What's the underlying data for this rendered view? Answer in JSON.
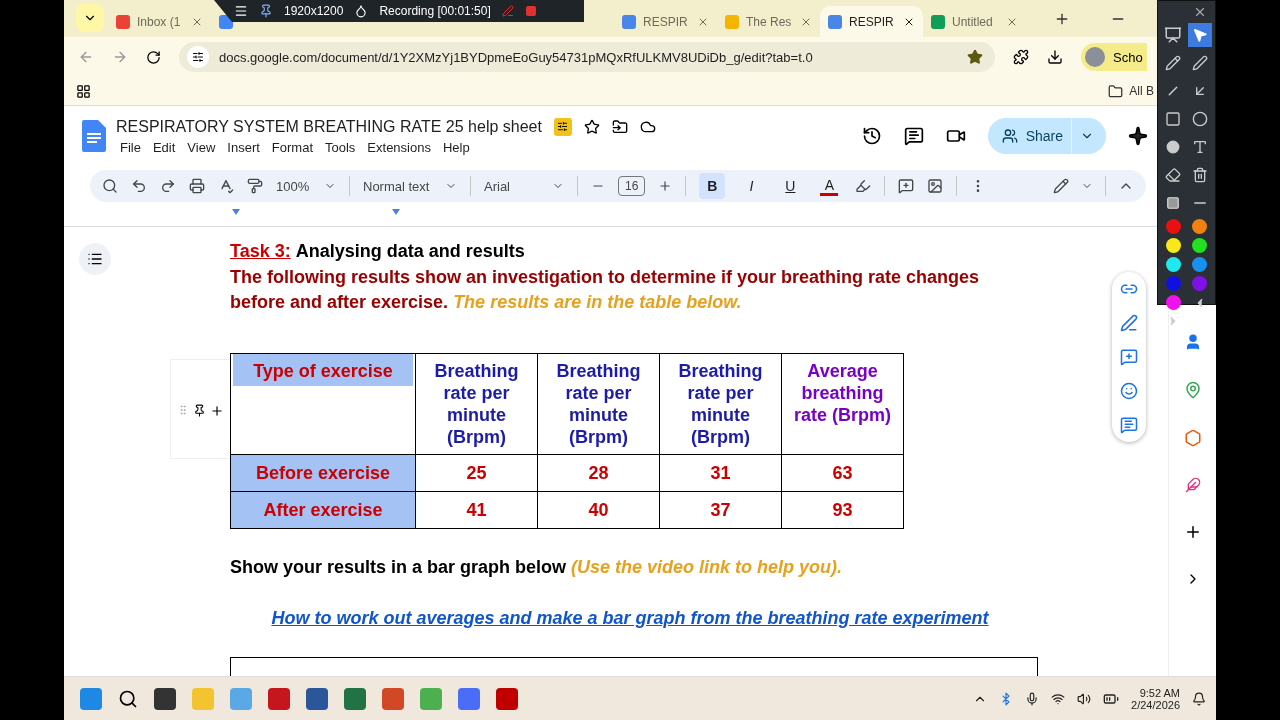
{
  "browser": {
    "tabs": [
      {
        "label": "Inbox (1",
        "kind": "mail",
        "selected": false
      },
      {
        "kind": "calendar",
        "selected": false
      },
      {
        "label": "RESPIR",
        "kind": "docs",
        "selected": false
      },
      {
        "label": "The Res",
        "kind": "slides",
        "selected": false
      },
      {
        "label": "RESPIR",
        "kind": "docs",
        "selected": true
      },
      {
        "label": "Untitled",
        "kind": "sheets",
        "selected": false
      }
    ],
    "recorder": {
      "resolution": "1920x1200",
      "status": "Recording [00:01:50]"
    },
    "url": "docs.google.com/document/d/1Y2XMzYj1BYDpmeEoGuy54731pMQxRfULKMV8UDiDb_g/edit?tab=t.0",
    "profile": "Scho",
    "bookmarks": "All B"
  },
  "docs": {
    "title": "RESPIRATORY SYSTEM BREATHING RATE 25 help sheet",
    "menu": [
      "File",
      "Edit",
      "View",
      "Insert",
      "Format",
      "Tools",
      "Extensions",
      "Help"
    ],
    "share": "Share",
    "toolbar": {
      "zoom": "100%",
      "style": "Normal text",
      "font": "Arial",
      "size": "16",
      "format": [
        {
          "kind": "bold",
          "label": "B",
          "selected": true
        },
        {
          "kind": "italic",
          "label": "I",
          "selected": false
        },
        {
          "kind": "underline",
          "label": "U",
          "selected": false
        },
        {
          "kind": "text_color",
          "label": "A",
          "selected": false
        }
      ]
    }
  },
  "document": {
    "task_label": "Task 3:",
    "task_title": "Analysing data and results",
    "intro": "The following results show an investigation to determine if your breathing rate changes before and after exercise.",
    "note": "The results are in the table below.",
    "table": {
      "columns": [
        {
          "label": "Type of exercise",
          "color": "#cc0000"
        },
        {
          "label": "Breathing rate per minute (Brpm)",
          "color": "#1c1ca8"
        },
        {
          "label": "Breathing rate per minute (Brpm)",
          "color": "#1c1ca8"
        },
        {
          "label": "Breathing rate per minute (Brpm)",
          "color": "#1c1ca8"
        },
        {
          "label": "Average breathing rate (Brpm)",
          "color": "#7a00c8"
        }
      ],
      "rows": [
        {
          "cells": [
            "Before exercise",
            "25",
            "28",
            "31",
            "63"
          ]
        },
        {
          "cells": [
            "After exercise",
            "41",
            "40",
            "37",
            "93"
          ]
        }
      ]
    },
    "prompt": "Show your results in a bar graph below",
    "prompt_note": "(Use the video link to help you).",
    "link": "How to work out averages and make a bar graph from the breathing rate experiment"
  },
  "draw_palette": [
    {
      "color": "#e81010"
    },
    {
      "color": "#f08010"
    },
    {
      "color": "#f8e81a"
    },
    {
      "color": "#20e020"
    },
    {
      "color": "#20e8f0"
    },
    {
      "color": "#1890f0"
    },
    {
      "color": "#1010e0"
    },
    {
      "color": "#8010e8"
    },
    {
      "color": "#f010f0"
    }
  ],
  "taskbar": {
    "time": "9:52 AM",
    "date": "2/24/2026"
  }
}
